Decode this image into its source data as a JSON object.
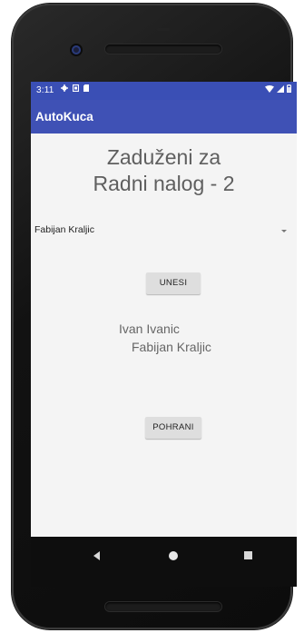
{
  "status_bar": {
    "time": "3:11",
    "left_icons": [
      "settings-icon",
      "sim-icon",
      "storage-icon"
    ],
    "right_icons": [
      "wifi-icon",
      "signal-icon",
      "battery-icon"
    ],
    "background": "#3a4fb5"
  },
  "app_bar": {
    "title": "AutoKuca",
    "background": "#3f51b5"
  },
  "heading": {
    "line1": "Zaduženi za",
    "line2": "Radni nalog - 2"
  },
  "spinner": {
    "selected": "Fabijan Kraljic",
    "icon": "dropdown-arrow-icon"
  },
  "buttons": {
    "unesi": "UNESI",
    "pohrani": "POHRANI"
  },
  "assigned_list": [
    "Ivan Ivanic",
    "Fabijan Kraljic"
  ],
  "nav_bar": {
    "icons": [
      "back-icon",
      "home-icon",
      "recent-apps-icon"
    ]
  }
}
